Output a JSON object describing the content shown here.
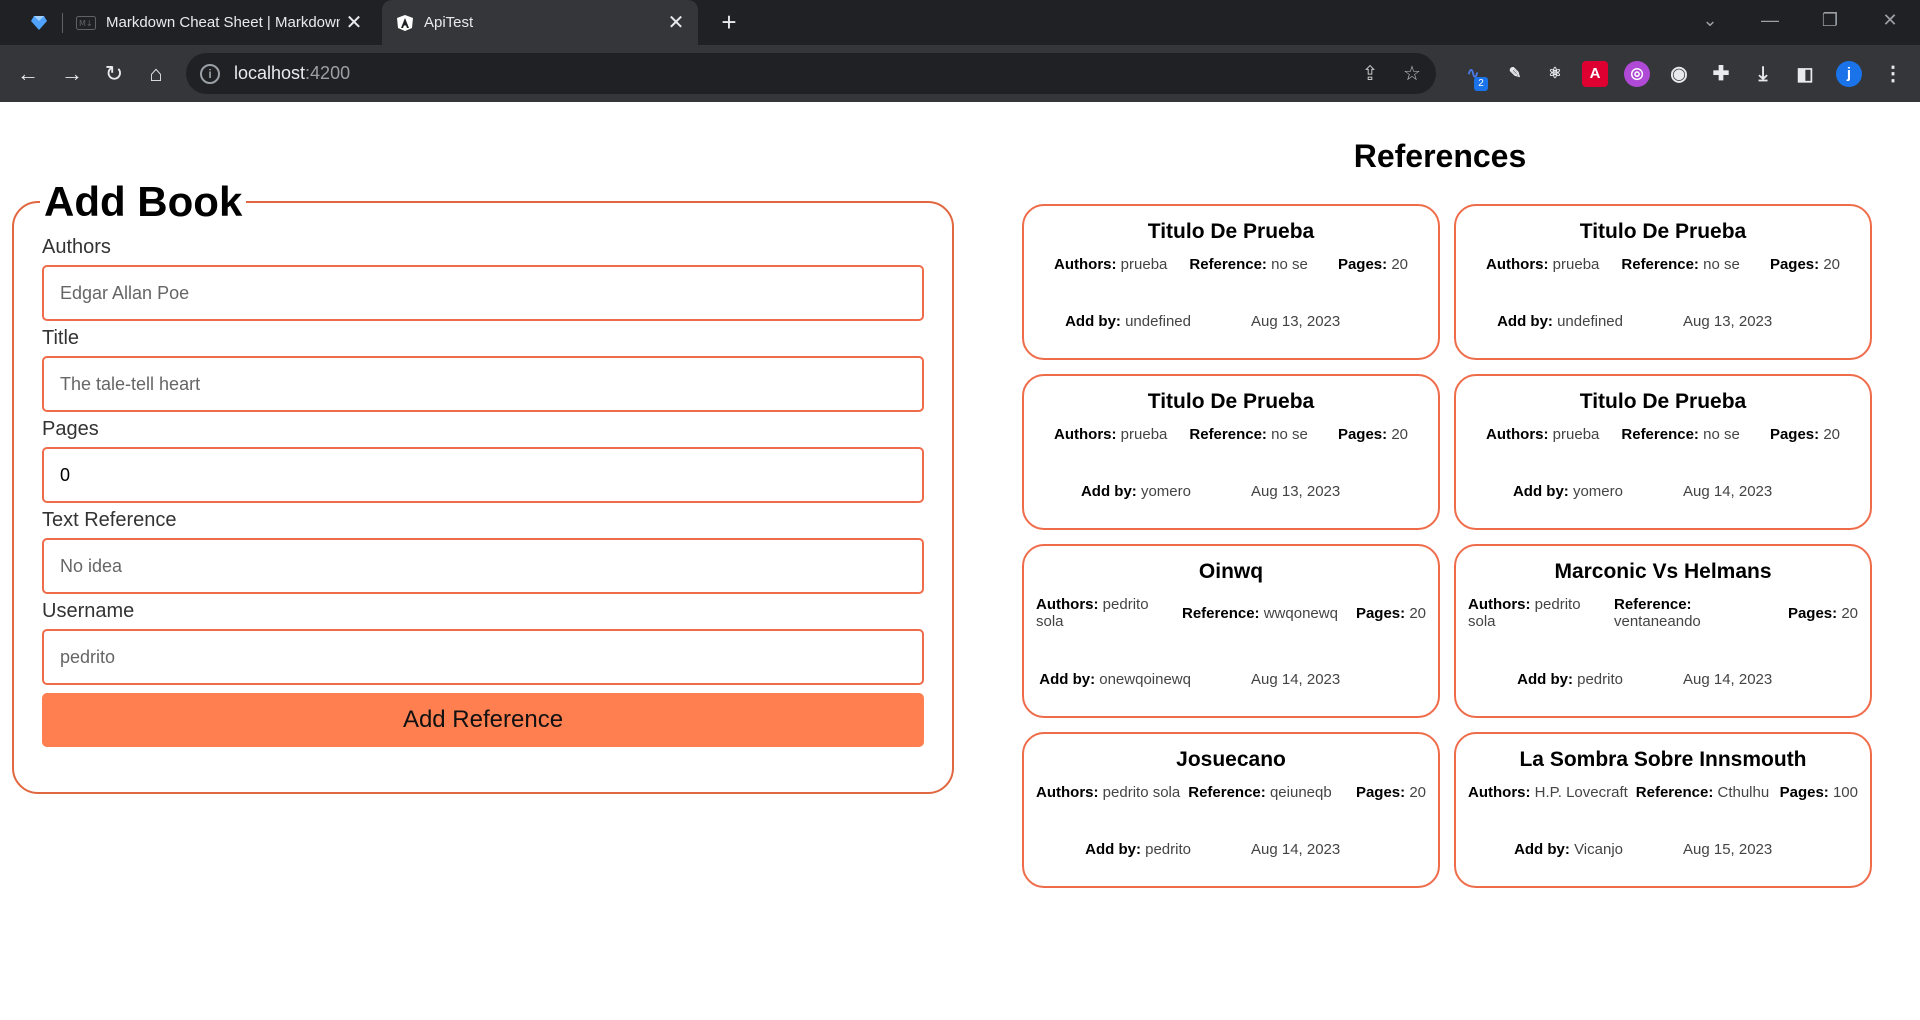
{
  "browser": {
    "tabs": [
      {
        "title": "Markdown Cheat Sheet | Markdown",
        "close": "✕"
      },
      {
        "title": "ApiTest",
        "close": "✕"
      }
    ],
    "new_tab": "+",
    "url_host": "localhost",
    "url_port": ":4200",
    "profile_initial": "j",
    "ext_badge": "2"
  },
  "form": {
    "legend": "Add Book",
    "fields": [
      {
        "label": "Authors",
        "placeholder": "Edgar Allan Poe",
        "value": ""
      },
      {
        "label": "Title",
        "placeholder": "The tale-tell heart",
        "value": ""
      },
      {
        "label": "Pages",
        "placeholder": "",
        "value": "0"
      },
      {
        "label": "Text Reference",
        "placeholder": "No idea",
        "value": ""
      },
      {
        "label": "Username",
        "placeholder": "pedrito",
        "value": ""
      }
    ],
    "submit_label": "Add Reference"
  },
  "references": {
    "title": "References",
    "labels": {
      "authors": "Authors:",
      "reference": "Reference:",
      "pages": "Pages:",
      "add_by": "Add by:"
    },
    "cards": [
      {
        "title": "Titulo De Prueba",
        "authors": "prueba",
        "reference": "no se",
        "pages": "20",
        "add_by": "undefined",
        "date": "Aug 13, 2023"
      },
      {
        "title": "Titulo De Prueba",
        "authors": "prueba",
        "reference": "no se",
        "pages": "20",
        "add_by": "undefined",
        "date": "Aug 13, 2023"
      },
      {
        "title": "Titulo De Prueba",
        "authors": "prueba",
        "reference": "no se",
        "pages": "20",
        "add_by": "yomero",
        "date": "Aug 13, 2023"
      },
      {
        "title": "Titulo De Prueba",
        "authors": "prueba",
        "reference": "no se",
        "pages": "20",
        "add_by": "yomero",
        "date": "Aug 14, 2023"
      },
      {
        "title": "Oinwq",
        "authors": "pedrito sola",
        "reference": "wwqonewq",
        "pages": "20",
        "add_by": "onewqoinewq",
        "date": "Aug 14, 2023"
      },
      {
        "title": "Marconic Vs Helmans",
        "authors": "pedrito sola",
        "reference": "ventaneando",
        "pages": "20",
        "add_by": "pedrito",
        "date": "Aug 14, 2023"
      },
      {
        "title": "Josuecano",
        "authors": "pedrito sola",
        "reference": "qeiuneqb",
        "pages": "20",
        "add_by": "pedrito",
        "date": "Aug 14, 2023"
      },
      {
        "title": "La Sombra Sobre Innsmouth",
        "authors": "H.P. Lovecraft",
        "reference": "Cthulhu",
        "pages": "100",
        "add_by": "Vicanjo",
        "date": "Aug 15, 2023"
      }
    ]
  },
  "colors": {
    "accent": "#ef6c4a",
    "button": "#ff7f50",
    "chrome_dark": "#202124",
    "chrome_mid": "#35363a"
  }
}
